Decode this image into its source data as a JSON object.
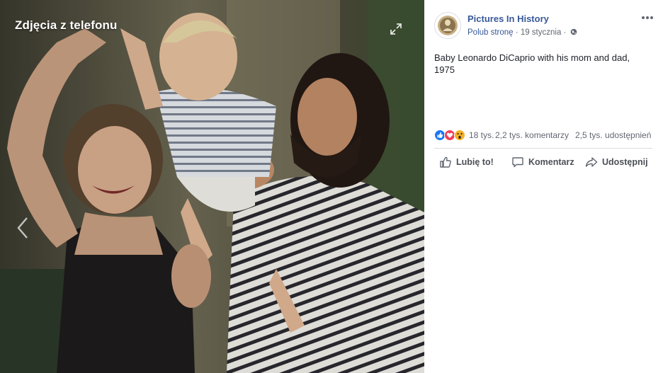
{
  "photo": {
    "album_title": "Zdjęcia z telefonu",
    "expand_icon": "expand-icon",
    "prev_icon": "chevron-left-icon"
  },
  "post": {
    "page_name": "Pictures In History",
    "follow_label": "Polub stronę",
    "separator": " · ",
    "date": "19 stycznia",
    "date_separator": " · ",
    "privacy_icon": "globe-icon",
    "more_icon": "more-icon",
    "text": "Baby Leonardo DiCaprio with his mom and dad, 1975"
  },
  "stats": {
    "reaction_icons": [
      "like-reaction-icon",
      "love-reaction-icon",
      "wow-reaction-icon"
    ],
    "reactions_count": "18 tys.",
    "comments_count": "2,2 tys. komentarzy",
    "shares_count": "2,5 tys. udostępnień"
  },
  "actions": {
    "like_label": "Lubię to!",
    "comment_label": "Komentarz",
    "share_label": "Udostępnij"
  },
  "colors": {
    "link_blue": "#385898",
    "secondary_text": "#616770",
    "divider": "#dadde1",
    "like_blue": "#1877f2",
    "love_red": "#f33e58",
    "wow_yellow": "#f7b125"
  }
}
